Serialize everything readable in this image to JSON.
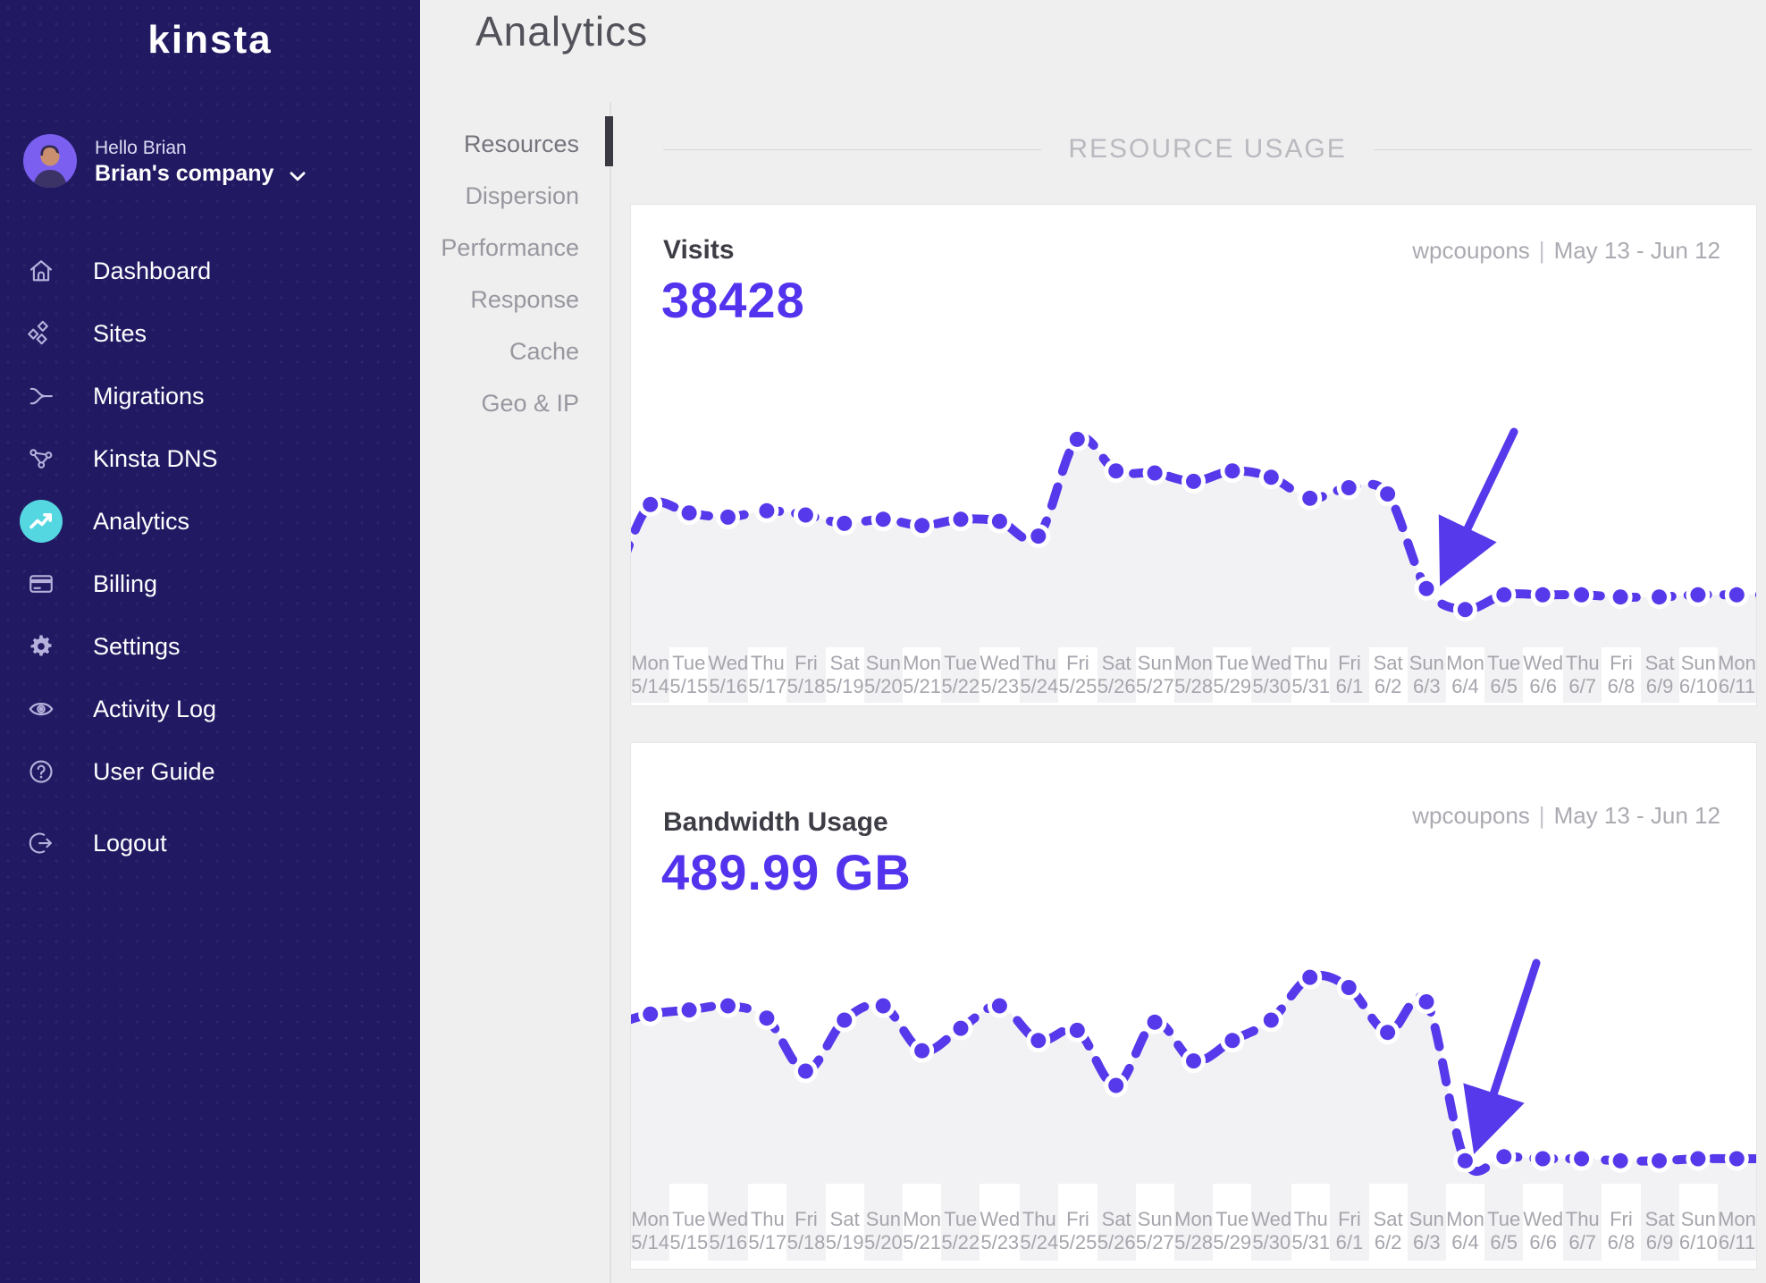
{
  "brand": {
    "logo_text": "kinsta"
  },
  "user": {
    "greeting": "Hello Brian",
    "company": "Brian's company"
  },
  "sidebar": {
    "items": [
      {
        "id": "dashboard",
        "label": "Dashboard",
        "icon": "home-icon",
        "active": false
      },
      {
        "id": "sites",
        "label": "Sites",
        "icon": "sites-icon",
        "active": false
      },
      {
        "id": "migrations",
        "label": "Migrations",
        "icon": "migrations-icon",
        "active": false
      },
      {
        "id": "kinsta-dns",
        "label": "Kinsta DNS",
        "icon": "dns-icon",
        "active": false
      },
      {
        "id": "analytics",
        "label": "Analytics",
        "icon": "analytics-icon",
        "active": true
      },
      {
        "id": "billing",
        "label": "Billing",
        "icon": "billing-icon",
        "active": false
      },
      {
        "id": "settings",
        "label": "Settings",
        "icon": "settings-icon",
        "active": false
      },
      {
        "id": "activity-log",
        "label": "Activity Log",
        "icon": "activity-log-icon",
        "active": false
      },
      {
        "id": "user-guide",
        "label": "User Guide",
        "icon": "user-guide-icon",
        "active": false
      },
      {
        "id": "logout",
        "label": "Logout",
        "icon": "logout-icon",
        "active": false
      }
    ]
  },
  "page": {
    "title": "Analytics"
  },
  "subnav": {
    "active": "Resources",
    "items": [
      "Resources",
      "Dispersion",
      "Performance",
      "Response",
      "Cache",
      "Geo & IP"
    ]
  },
  "section_title": "RESOURCE USAGE",
  "colors": {
    "sidebar_bg": "#211a63",
    "accent_purple": "#5333ed",
    "chart_line": "#5639ea",
    "active_teal": "#55d7e2",
    "area_fill": "#f2f2f4",
    "page_bg": "#efeff0"
  },
  "chart_data": [
    {
      "type": "line",
      "title": "Visits",
      "total": "38428",
      "site": "wpcoupons",
      "separator": "|",
      "date_range": "May 13 - Jun 12",
      "categories": [
        "5/14",
        "5/15",
        "5/16",
        "5/17",
        "5/18",
        "5/19",
        "5/20",
        "5/21",
        "5/22",
        "5/23",
        "5/24",
        "5/25",
        "5/26",
        "5/27",
        "5/28",
        "5/29",
        "5/30",
        "5/31",
        "6/1",
        "6/2",
        "6/3",
        "6/4",
        "6/5",
        "6/6",
        "6/7",
        "6/8",
        "6/9",
        "6/10",
        "6/11"
      ],
      "categories_day_of_week": [
        "Mon",
        "Tue",
        "Wed",
        "Thu",
        "Fri",
        "Sat",
        "Sun",
        "Mon",
        "Tue",
        "Wed",
        "Thu",
        "Fri",
        "Sat",
        "Sun",
        "Mon",
        "Tue",
        "Wed",
        "Thu",
        "Fri",
        "Sat",
        "Sun",
        "Mon",
        "Tue",
        "Wed",
        "Thu",
        "Fri",
        "Sat",
        "Sun",
        "Mon"
      ],
      "values": [
        62,
        58,
        56,
        59,
        57,
        53,
        55,
        52,
        55,
        54,
        47,
        93,
        78,
        77,
        73,
        78,
        75,
        65,
        70,
        67,
        22,
        12,
        19,
        19,
        19,
        18,
        18,
        19,
        19
      ],
      "value_scale": "relative height 0-100, no y-axis shown in UI",
      "lead_in": 34,
      "annotation": {
        "type": "arrow",
        "direction": "down-left",
        "points_at_date": "6/3"
      },
      "legend_shown": false,
      "y_axis_shown": false,
      "grid_shown": false
    },
    {
      "type": "line",
      "title": "Bandwidth Usage",
      "total": "489.99 GB",
      "site": "wpcoupons",
      "separator": "|",
      "date_range": "May 13 - Jun 12",
      "categories": [
        "5/14",
        "5/15",
        "5/16",
        "5/17",
        "5/18",
        "5/19",
        "5/20",
        "5/21",
        "5/22",
        "5/23",
        "5/24",
        "5/25",
        "5/26",
        "5/27",
        "5/28",
        "5/29",
        "5/30",
        "5/31",
        "6/1",
        "6/2",
        "6/3",
        "6/4",
        "6/5",
        "6/6",
        "6/7",
        "6/8",
        "6/9",
        "6/10",
        "6/11"
      ],
      "categories_day_of_week": [
        "Mon",
        "Tue",
        "Wed",
        "Thu",
        "Fri",
        "Sat",
        "Sun",
        "Mon",
        "Tue",
        "Wed",
        "Thu",
        "Fri",
        "Sat",
        "Sun",
        "Mon",
        "Tue",
        "Wed",
        "Thu",
        "Fri",
        "Sat",
        "Sun",
        "Mon",
        "Tue",
        "Wed",
        "Thu",
        "Fri",
        "Sat",
        "Sun",
        "Mon"
      ],
      "values": [
        78,
        80,
        82,
        76,
        50,
        75,
        82,
        60,
        71,
        82,
        65,
        70,
        43,
        74,
        55,
        65,
        75,
        96,
        91,
        69,
        84,
        6,
        8,
        7,
        7,
        6,
        6,
        7,
        7
      ],
      "value_scale": "relative height 0-100, no y-axis shown in UI",
      "lead_in": 74,
      "annotation": {
        "type": "arrow",
        "direction": "down-left",
        "points_at_date": "6/4"
      },
      "legend_shown": false,
      "y_axis_shown": false,
      "grid_shown": false
    }
  ]
}
